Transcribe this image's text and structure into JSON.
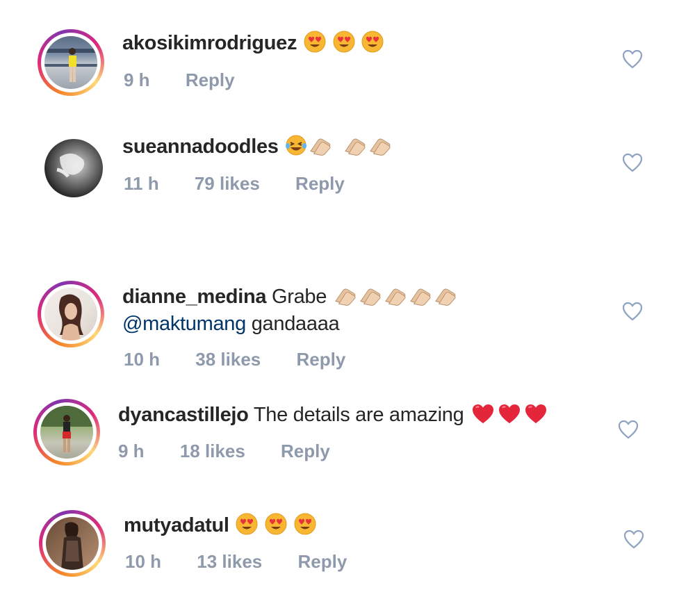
{
  "comments": [
    {
      "username": "akosikimrodriguez",
      "text": "",
      "emoji": [
        "heart-eyes",
        "heart-eyes",
        "heart-eyes"
      ],
      "time": "9 h",
      "likes": "",
      "reply": "Reply",
      "ring": true
    },
    {
      "username": "sueannadoodles",
      "text": "",
      "emoji": [
        "laughing-tears",
        "clapping-hands",
        "clapping-hands",
        "clapping-hands"
      ],
      "time": "11 h",
      "likes": "79 likes",
      "reply": "Reply",
      "ring": false
    },
    {
      "username": "dianne_medina",
      "text": "Grabe",
      "emoji": [
        "clapping-hands",
        "clapping-hands",
        "clapping-hands",
        "clapping-hands",
        "clapping-hands"
      ],
      "mention": "@maktumang",
      "text2": "gandaaaa",
      "time": "10 h",
      "likes": "38 likes",
      "reply": "Reply",
      "ring": true
    },
    {
      "username": "dyancastillejo",
      "text": "The details are amazing",
      "emoji": [
        "red-heart",
        "red-heart",
        "red-heart"
      ],
      "time": "9 h",
      "likes": "18 likes",
      "reply": "Reply",
      "ring": true
    },
    {
      "username": "mutyadatul",
      "text": "",
      "emoji": [
        "heart-eyes",
        "heart-eyes",
        "heart-eyes"
      ],
      "time": "10 h",
      "likes": "13 likes",
      "reply": "Reply",
      "ring": true
    }
  ],
  "colors": {
    "username": "#262626",
    "meta": "#8e9aab",
    "mention": "#003569",
    "heart_outline": "#8fa3c0"
  }
}
